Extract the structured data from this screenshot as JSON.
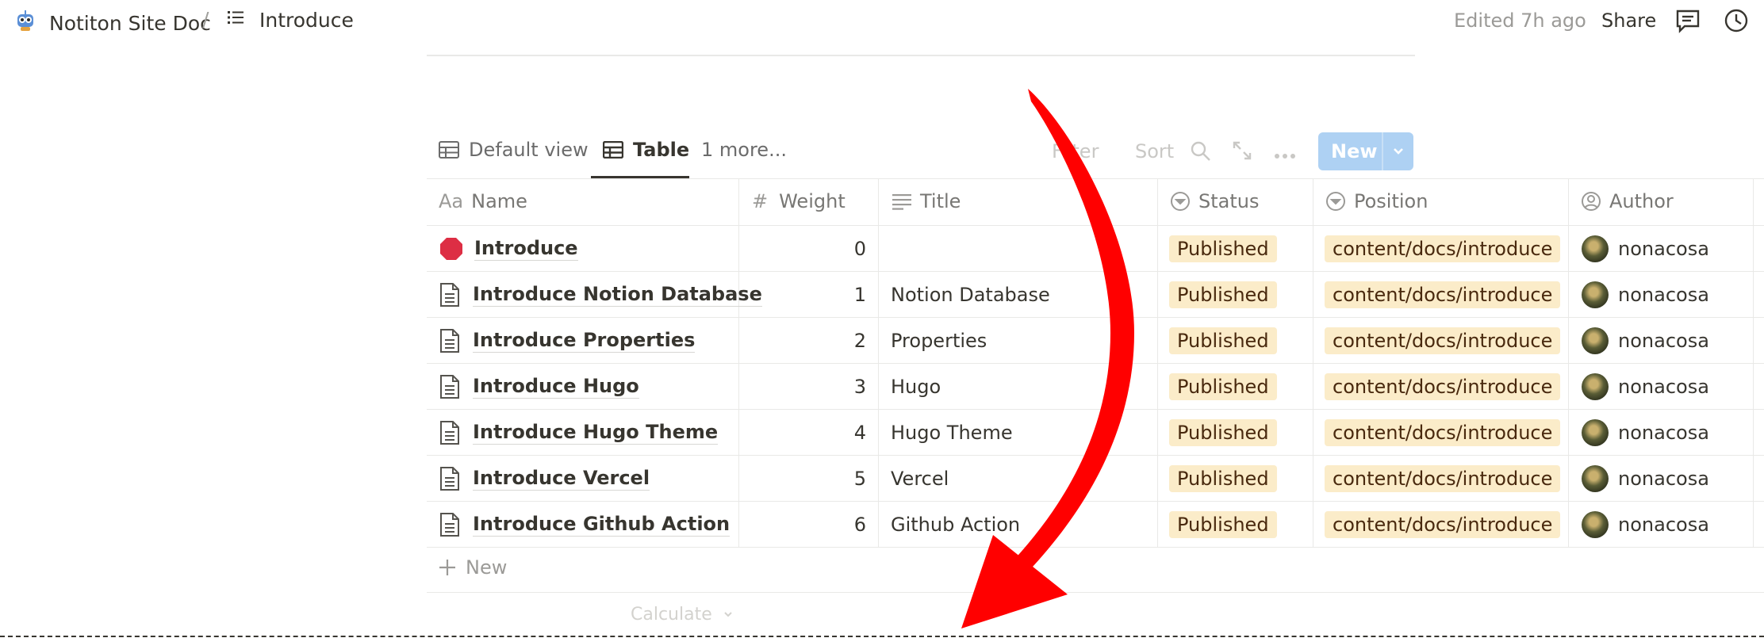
{
  "breadcrumb": {
    "workspace": "Notiton Site Doc",
    "separator": "/",
    "page": "Introduce"
  },
  "topbar": {
    "edited": "Edited 7h ago",
    "share": "Share"
  },
  "views": {
    "tabs": [
      {
        "label": "Default view"
      },
      {
        "label": "Table"
      }
    ],
    "more": "1 more...",
    "filter": "Filter",
    "sort": "Sort",
    "new_label": "New"
  },
  "table": {
    "headers": {
      "name": "Name",
      "weight": "Weight",
      "title": "Title",
      "status": "Status",
      "position": "Position",
      "author": "Author"
    },
    "rows": [
      {
        "name": "Introduce",
        "weight": "0",
        "title": "",
        "status": "Published",
        "position": "content/docs/introduce",
        "author": "nonacosa"
      },
      {
        "name": "Introduce Notion Database",
        "weight": "1",
        "title": "Notion Database",
        "status": "Published",
        "position": "content/docs/introduce",
        "author": "nonacosa"
      },
      {
        "name": "Introduce Properties",
        "weight": "2",
        "title": "Properties",
        "status": "Published",
        "position": "content/docs/introduce",
        "author": "nonacosa"
      },
      {
        "name": "Introduce Hugo",
        "weight": "3",
        "title": "Hugo",
        "status": "Published",
        "position": "content/docs/introduce",
        "author": "nonacosa"
      },
      {
        "name": "Introduce Hugo Theme",
        "weight": "4",
        "title": "Hugo Theme",
        "status": "Published",
        "position": "content/docs/introduce",
        "author": "nonacosa"
      },
      {
        "name": "Introduce Vercel",
        "weight": "5",
        "title": "Vercel",
        "status": "Published",
        "position": "content/docs/introduce",
        "author": "nonacosa"
      },
      {
        "name": "Introduce Github Action",
        "weight": "6",
        "title": "Github Action",
        "status": "Published",
        "position": "content/docs/introduce",
        "author": "nonacosa"
      }
    ],
    "new_row": "New",
    "calculate": "Calculate"
  },
  "colors": {
    "status_tag_bg": "#fbecc9",
    "new_button_bg": "#aed1f3",
    "annotation_arrow": "#ff0000"
  },
  "icons": {
    "workspace": "robot-icon",
    "page": "list-icon",
    "comments": "comment-icon",
    "history": "clock-icon",
    "first_row": "stop-sign-icon",
    "rows": "document-icon"
  }
}
